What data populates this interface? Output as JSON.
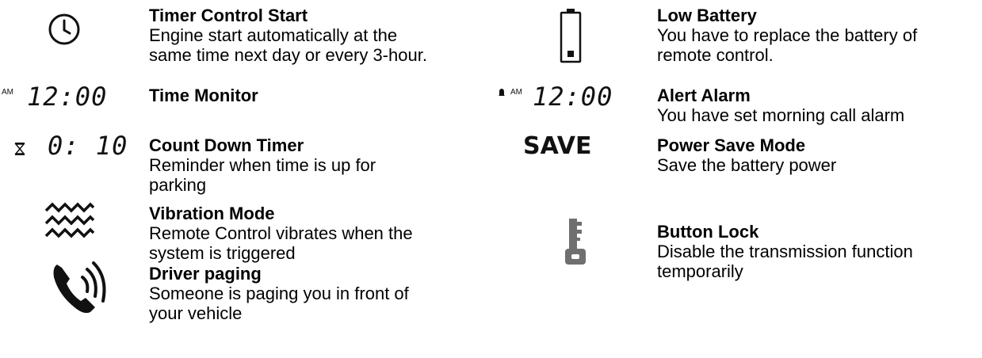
{
  "left": [
    {
      "icon": "clock-icon",
      "title": "Timer Control Start",
      "desc": [
        "Engine start automatically at the",
        "same time next day or every 3-hour."
      ]
    },
    {
      "icon": "lcd-time-icon",
      "title": "Time Monitor",
      "desc": [],
      "lcd": {
        "am": "AM",
        "time": "12:00"
      }
    },
    {
      "icon": "hourglass-countdown-icon",
      "title": "Count Down Timer",
      "desc": [
        "Reminder when time is up for",
        "parking"
      ],
      "lcd": {
        "time": "0: 10"
      }
    },
    {
      "icon": "vibration-icon",
      "title": "Vibration Mode",
      "desc": [
        "Remote Control vibrates when the",
        "system is triggered"
      ]
    },
    {
      "icon": "phone-paging-icon",
      "title": "Driver paging",
      "desc": [
        "Someone is paging you in front of",
        "your vehicle"
      ]
    }
  ],
  "right": [
    {
      "icon": "low-battery-icon",
      "title": "Low Battery",
      "desc": [
        "You have to replace the battery of",
        "remote control."
      ]
    },
    {
      "icon": "alarm-time-icon",
      "title": "Alert Alarm",
      "desc": [
        "You have set morning call alarm"
      ],
      "lcd": {
        "am": "AM",
        "time": "12:00"
      }
    },
    {
      "icon": "save-icon",
      "title": "Power Save Mode",
      "desc": [
        "Save the battery power"
      ],
      "lcd": {
        "text": "SAVE"
      }
    },
    {
      "icon": "key-lock-icon",
      "title": "Button Lock",
      "desc": [
        "Disable the transmission function",
        "temporarily"
      ]
    }
  ]
}
